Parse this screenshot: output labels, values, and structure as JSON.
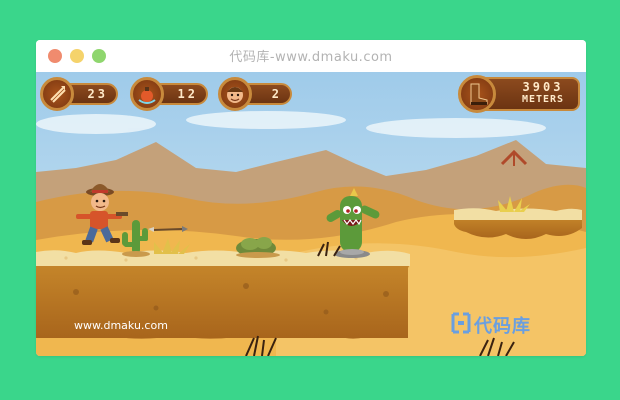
{
  "window": {
    "title": "代码库-www.dmaku.com",
    "controls": [
      {
        "name": "close",
        "color": "#f08b6e"
      },
      {
        "name": "minimize",
        "color": "#f5d36b"
      },
      {
        "name": "maximize",
        "color": "#8fd66e"
      }
    ]
  },
  "hud": {
    "arrows": {
      "icon": "arrows-icon",
      "value": "23"
    },
    "bombs": {
      "icon": "bomb-icon",
      "value": "12"
    },
    "lives": {
      "icon": "player-face-icon",
      "value": "2"
    },
    "distance": {
      "icon": "boot-icon",
      "value": "3903",
      "unit": "METERS"
    }
  },
  "watermark": {
    "url": "www.dmaku.com",
    "logo_text": "代码库"
  },
  "colors": {
    "page_bg": "#3ad68b",
    "sky": "#a9d2ee",
    "sand": "#f0b74f",
    "ground_top": "#f2dfa4",
    "ground_body": "#c9862a",
    "hud_brown": "#7a3611",
    "hud_border": "#c88a3c"
  }
}
